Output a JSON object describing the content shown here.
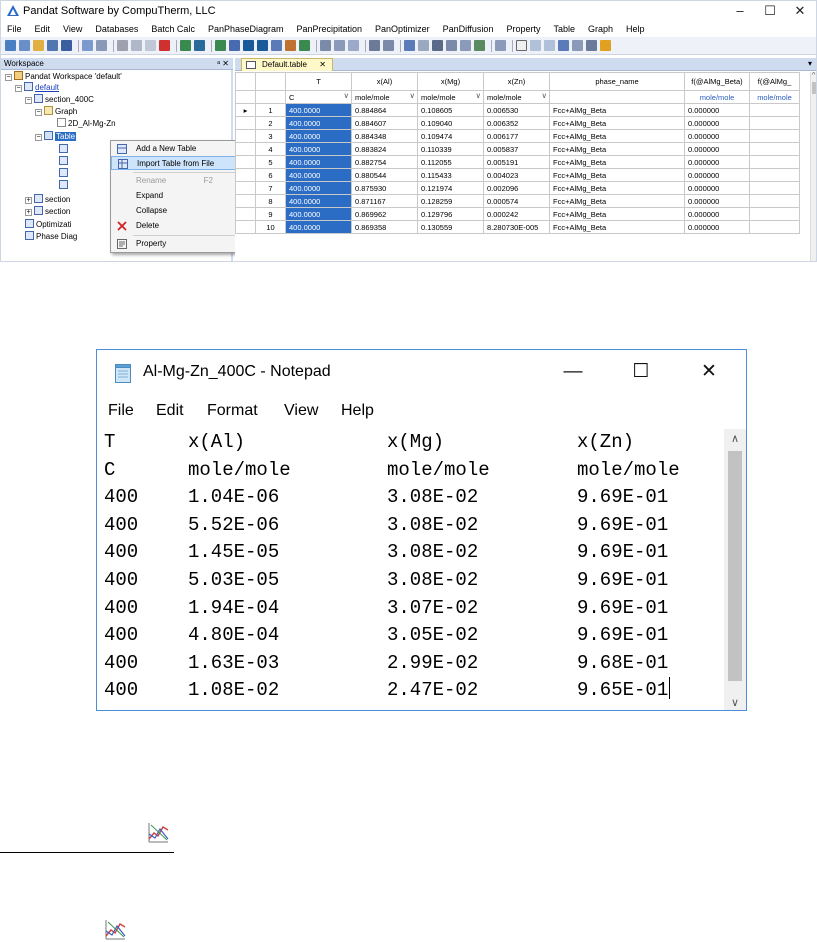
{
  "pandat": {
    "title": "Pandat Software by CompuTherm, LLC",
    "menu": [
      "File",
      "Edit",
      "View",
      "Databases",
      "Batch Calc",
      "PanPhaseDiagram",
      "PanPrecipitation",
      "PanOptimizer",
      "PanDiffusion",
      "Property",
      "Table",
      "Graph",
      "Help"
    ],
    "workspace_label": "Workspace",
    "workspace_pin": "ᵃ ✕",
    "tree": {
      "root": "Pandat Workspace 'default'",
      "default": "default",
      "section_400c": "section_400C",
      "graph": "Graph",
      "graph_item": "2D_Al-Mg-Zn",
      "table": "Table",
      "section_a": "section",
      "section_b": "section",
      "optimization": "Optimizati",
      "phase_diagram": "Phase Diag"
    },
    "context_menu": {
      "add_table": "Add a New Table",
      "import_table": "Import Table from File",
      "rename": "Rename",
      "rename_shortcut": "F2",
      "expand": "Expand",
      "collapse": "Collapse",
      "delete": "Delete",
      "property": "Property"
    },
    "doc_tab": "Default.table",
    "doc_tab_close": "✕",
    "grid": {
      "headers": [
        "T",
        "x(Al)",
        "x(Mg)",
        "x(Zn)",
        "phase_name",
        "f(@AlMg_Beta)",
        "f(@AlMg_"
      ],
      "units": [
        "C",
        "mole/mole",
        "mole/mole",
        "mole/mole",
        "",
        "mole/mole",
        "mole/mole"
      ],
      "rows": [
        [
          "1",
          "400.0000",
          "0.884864",
          "0.108605",
          "0.006530",
          "Fcc+AlMg_Beta",
          "0.000000"
        ],
        [
          "2",
          "400.0000",
          "0.884607",
          "0.109040",
          "0.006352",
          "Fcc+AlMg_Beta",
          "0.000000"
        ],
        [
          "3",
          "400.0000",
          "0.884348",
          "0.109474",
          "0.006177",
          "Fcc+AlMg_Beta",
          "0.000000"
        ],
        [
          "4",
          "400.0000",
          "0.883824",
          "0.110339",
          "0.005837",
          "Fcc+AlMg_Beta",
          "0.000000"
        ],
        [
          "5",
          "400.0000",
          "0.882754",
          "0.112055",
          "0.005191",
          "Fcc+AlMg_Beta",
          "0.000000"
        ],
        [
          "6",
          "400.0000",
          "0.880544",
          "0.115433",
          "0.004023",
          "Fcc+AlMg_Beta",
          "0.000000"
        ],
        [
          "7",
          "400.0000",
          "0.875930",
          "0.121974",
          "0.002096",
          "Fcc+AlMg_Beta",
          "0.000000"
        ],
        [
          "8",
          "400.0000",
          "0.871167",
          "0.128259",
          "0.000574",
          "Fcc+AlMg_Beta",
          "0.000000"
        ],
        [
          "9",
          "400.0000",
          "0.869962",
          "0.129796",
          "0.000242",
          "Fcc+AlMg_Beta",
          "0.000000"
        ],
        [
          "10",
          "400.0000",
          "0.869358",
          "0.130559",
          "8.280730E-005",
          "Fcc+AlMg_Beta",
          "0.000000"
        ]
      ]
    }
  },
  "notepad": {
    "title": "Al-Mg-Zn_400C - Notepad",
    "menu": [
      "File",
      "Edit",
      "Format",
      "View",
      "Help"
    ],
    "lines": [
      [
        "T",
        "x(Al)",
        "x(Mg)",
        "x(Zn)"
      ],
      [
        "C",
        "mole/mole",
        "mole/mole",
        "mole/mole"
      ],
      [
        "400",
        "1.04E-06",
        "3.08E-02",
        "9.69E-01"
      ],
      [
        "400",
        "5.52E-06",
        "3.08E-02",
        "9.69E-01"
      ],
      [
        "400",
        "1.45E-05",
        "3.08E-02",
        "9.69E-01"
      ],
      [
        "400",
        "5.03E-05",
        "3.08E-02",
        "9.69E-01"
      ],
      [
        "400",
        "1.94E-04",
        "3.07E-02",
        "9.69E-01"
      ],
      [
        "400",
        "4.80E-04",
        "3.05E-02",
        "9.69E-01"
      ],
      [
        "400",
        "1.63E-03",
        "2.99E-02",
        "9.68E-01"
      ],
      [
        "400",
        "1.08E-02",
        "2.47E-02",
        "9.65E-01"
      ]
    ]
  },
  "colors": {
    "selection": "#2b6cc4",
    "menu_hover": "#cde4fb",
    "tab_active": "#fff8c8",
    "link": "#1a3fb5"
  }
}
